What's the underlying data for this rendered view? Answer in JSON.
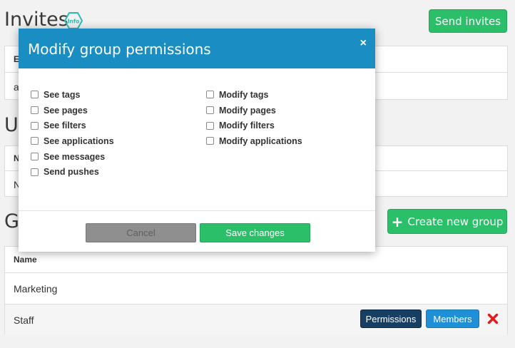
{
  "invites": {
    "title": "Invites",
    "info_label": "Info",
    "send_button": "Send invites",
    "header_cell": "E-",
    "row_cell": "a"
  },
  "users": {
    "title": "Us",
    "header_cell": "N",
    "row_cell": "N"
  },
  "groups": {
    "title": "Gr",
    "create_button": "Create new group",
    "column_name": "Name",
    "rows": [
      {
        "name": "Marketing"
      },
      {
        "name": "Staff",
        "permissions_button": "Permissions",
        "members_button": "Members"
      }
    ]
  },
  "modal": {
    "title": "Modify group permissions",
    "close": "×",
    "left_permissions": [
      "See tags",
      "See pages",
      "See filters",
      "See applications",
      "See messages",
      "Send pushes"
    ],
    "right_permissions": [
      "Modify tags",
      "Modify pages",
      "Modify filters",
      "Modify applications"
    ],
    "cancel_button": "Cancel",
    "save_button": "Save changes"
  },
  "colors": {
    "modal_header": "#1a8ec2",
    "success_green": "#2cbf6a",
    "permissions_navy": "#173f63",
    "members_blue": "#1f90d6",
    "delete_red": "#e21b1b"
  },
  "icons": {
    "info": "info-badge-icon",
    "close": "close-icon",
    "delete": "delete-x-icon",
    "plus": "plus-icon"
  }
}
